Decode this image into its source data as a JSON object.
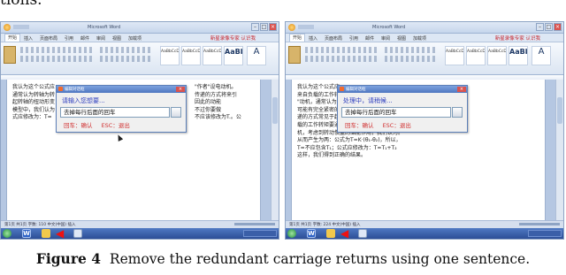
{
  "page_fragment": "tions.",
  "screens": [
    {
      "window_title": "Microsoft Word",
      "tabs": [
        "开始",
        "插入",
        "页面布局",
        "引用",
        "邮件",
        "审阅",
        "视图",
        "加载项"
      ],
      "user_label": "新星录像专家 认识我",
      "style_samples": [
        "AaBbCcDd",
        "AaBbCcDd",
        "AaBbCcDd",
        "AaBbC",
        "A"
      ],
      "dialog": {
        "caption": "编辑对话框",
        "prompt": "请输入您想要...",
        "input_value": "去掉每行后面的回车",
        "hints": [
          "回车：确认",
          "ESC：退出"
        ]
      },
      "document_lines": [
        "我认为这个公式应",
        "通常认为转轴为转",
        "起转轴的扭动形变",
        "模型中，我们认为",
        "式应修改为：T="
      ],
      "document_lines_right": [
        "\"作者\"设电动机。",
        "传递的方式将来引",
        "因此的动能",
        "不过你要做",
        "不应该修改为T.。公"
      ],
      "status_text": "第1页 共1页  字数: 110  中文(中国)  插入"
    },
    {
      "window_title": "Microsoft Word",
      "tabs": [
        "开始",
        "插入",
        "页面布局",
        "引用",
        "邮件",
        "审阅",
        "视图",
        "加载项"
      ],
      "user_label": "新星录像专家 认识我",
      "style_samples": [
        "AaBbCcDd",
        "AaBbCcDd",
        "AaBbCcDd",
        "AaBbC",
        "A"
      ],
      "dialog": {
        "caption": "编辑对话框",
        "prompt": "处理中，请稍候...",
        "input_value": "去掉每行后面的回车",
        "hints": [
          "回车：确认",
          "ESC：退出"
        ]
      },
      "document_lines": [
        "我认为这个公式应",
        "来自负载的工作转矩是经过转轴传递\"作者\"设",
        "\"动机，通常认为转轴为刚性，实际中下",
        "可能有完全紧密的耦合，所以因此，传统",
        "递的方式常见于起转轴的扭动形变。完全在",
        "载的工作转矩要通过转轴\"传递\"给电动",
        "机，考虑到转动惯量的储能作用，我们认为。",
        "从而产生为两：公式为T=K·(θ₁-θ₂)，所以，",
        "T=不应包含T₁；公式应修改为：T=T₁+T₂",
        "这样，我们得到正确的结果。"
      ],
      "status_text": "第1页 共1页  字数: 224  中文(中国)  插入"
    }
  ],
  "taskbar": {
    "word_icon_label": "W",
    "back_arrow": "◀"
  },
  "caption": {
    "label": "Figure 4",
    "text": "Remove the redundant carriage returns using one sentence."
  }
}
